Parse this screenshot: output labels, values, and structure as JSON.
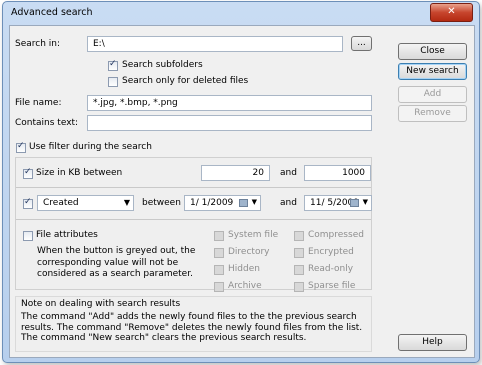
{
  "window": {
    "title": "Advanced search",
    "close_glyph": "✕"
  },
  "search": {
    "search_in_label": "Search in:",
    "search_in_value": "E:\\",
    "browse_label": "...",
    "subfolders_label": "Search subfolders",
    "subfolders_checked": true,
    "deleted_only_label": "Search only for deleted files",
    "deleted_only_checked": false,
    "file_name_label": "File name:",
    "file_name_value": "*.jpg, *.bmp, *.png",
    "contains_label": "Contains text:",
    "contains_value": ""
  },
  "buttons": {
    "close": "Close",
    "new_search": "New search",
    "add": "Add",
    "remove": "Remove",
    "help": "Help"
  },
  "filter": {
    "use_filter_label": "Use filter during the search",
    "use_filter_checked": true,
    "size_label": "Size in KB between",
    "size_checked": true,
    "size_min": "20",
    "and1": "and",
    "size_max": "1000",
    "date_checked": true,
    "date_type": "Created",
    "between_label": "between",
    "date_from": "1/ 1/2009",
    "and2": "and",
    "date_to": "11/ 5/2009",
    "attributes_label": "File attributes",
    "attributes_note": "When the button is greyed out, the corresponding value will not be considered as a search parameter.",
    "attributes": [
      "System file",
      "Directory",
      "Hidden",
      "Archive"
    ],
    "attributes2": [
      "Compressed",
      "Encrypted",
      "Read-only",
      "Sparse file"
    ]
  },
  "note": {
    "title": "Note on dealing with search results",
    "body": "The command \"Add\" adds the newly found files to the the previous search results. The command \"Remove\" deletes the newly found files from the list. The command \"New search\" clears the previous search results."
  }
}
